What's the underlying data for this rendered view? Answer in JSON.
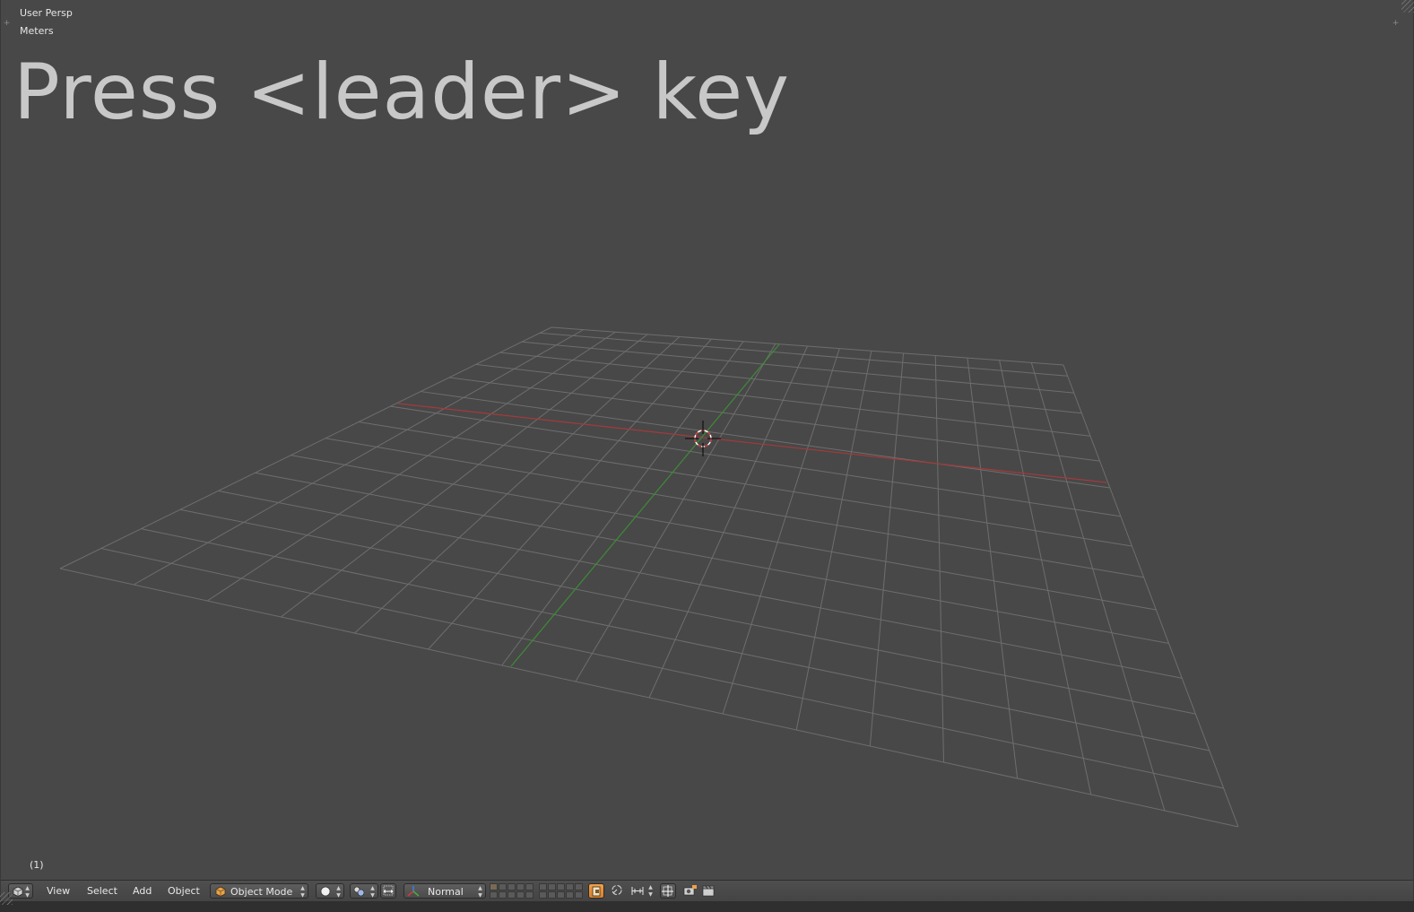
{
  "viewport": {
    "view_label": "User Persp",
    "units_label": "Meters",
    "overlay_text": "Press <leader> key",
    "frame_label": "(1)",
    "colors": {
      "background": "#484848",
      "grid": "#6e6e6e",
      "x_axis": "#a33a3a",
      "y_axis": "#3d8c36"
    }
  },
  "header": {
    "editor_type_icon": "3d-view-icon",
    "menus": [
      "View",
      "Select",
      "Add",
      "Object"
    ],
    "mode": {
      "icon": "object-mode-cube-icon",
      "value": "Object Mode"
    },
    "shading_icon": "solid-sphere-icon",
    "pivot_icon": "pivot-point-icon",
    "manipulator_icon": "manipulator-arrows-icon",
    "orientation": {
      "icon": "transform-axes-icon",
      "value": "Normal"
    },
    "lock_camera_icon": "lock-scene-layers-icon",
    "proportional_edit_icon": "proportional-edit-icon",
    "snap_icon": "snap-magnet-icon",
    "snap_target_icon": "snap-target-icon",
    "render_icon": "render-still-icon",
    "render_anim_icon": "render-animation-icon",
    "accent": "#e8933c"
  }
}
